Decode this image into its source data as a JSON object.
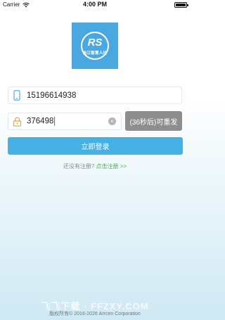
{
  "status_bar": {
    "carrier": "Carrier",
    "time": "4:00 PM"
  },
  "logo": {
    "text": "内江智慧人社"
  },
  "phone_field": {
    "value": "15196614938"
  },
  "code_field": {
    "value": "376498"
  },
  "resend_button": {
    "label": "(36秒后)可重发"
  },
  "login_button": {
    "label": "立即登录"
  },
  "register": {
    "prompt": "还没有注册?",
    "link": "点击注册 >>"
  },
  "watermark": "飞飞下载 · FFZXY.COM",
  "copyright": "版权所有© 2016-2026 Arrcen Corporation",
  "colors": {
    "accent": "#45b2e3",
    "logo_bg": "#4aa8e0",
    "resend_bg": "#8e8e8e",
    "register_link": "#3fbb3a"
  }
}
